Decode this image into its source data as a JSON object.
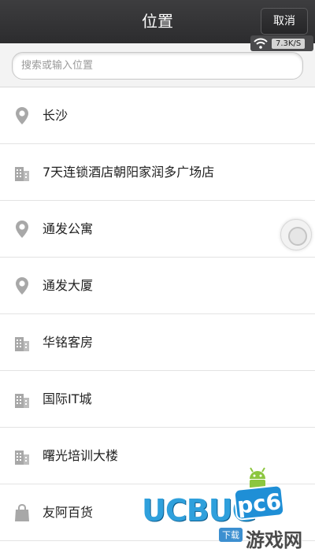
{
  "header": {
    "title": "位置",
    "cancel_label": "取消"
  },
  "status": {
    "net_speed": "7.3K/S",
    "wifi_icon": "wifi-icon"
  },
  "search": {
    "placeholder": "搜索或输入位置"
  },
  "locations": [
    {
      "label": "长沙",
      "icon": "map-pin-icon"
    },
    {
      "label": "7天连锁酒店朝阳家润多广场店",
      "icon": "building-icon"
    },
    {
      "label": "通发公寓",
      "icon": "map-pin-icon"
    },
    {
      "label": "通发大厦",
      "icon": "map-pin-icon"
    },
    {
      "label": "华铭客房",
      "icon": "building-icon"
    },
    {
      "label": "国际IT城",
      "icon": "building-icon"
    },
    {
      "label": "曙光培训大楼",
      "icon": "building-icon"
    },
    {
      "label": "友阿百货",
      "icon": "shopping-bag-icon"
    }
  ],
  "watermark": {
    "brand": "UCBUG",
    "badge": "pc6",
    "sub": "下载",
    "cn": "游戏网"
  },
  "colors": {
    "topbar": "#2c2c2e",
    "icon_gray": "#a8a8a8",
    "divider": "#e3e3e3"
  }
}
